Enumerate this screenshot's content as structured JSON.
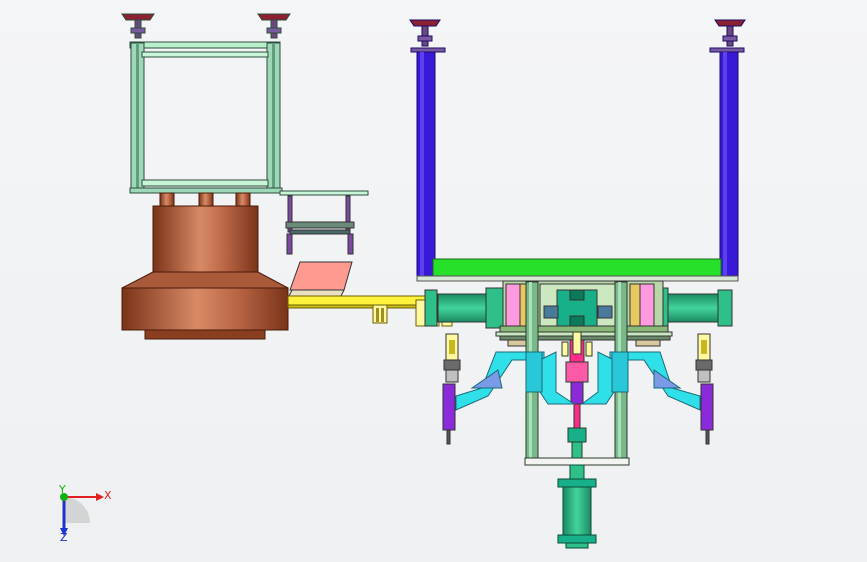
{
  "viewport": {
    "background": "#f3f4f6"
  },
  "triad": {
    "x_label": "X",
    "y_label": "Y",
    "z_label": "Z",
    "colors": {
      "x": "#e02020",
      "y": "#10b010",
      "z": "#2030d0"
    }
  },
  "palette": {
    "outline": "#333333",
    "frame_green": "#9fd8b8",
    "frame_dark_green": "#5f9f7f",
    "frame_blue": "#3a18d8",
    "base_bright_green": "#27e02a",
    "copper": "#9b4a2a",
    "copper_light": "#d08060",
    "yellow_arm": "#fff23a",
    "cyan_bracket": "#30e0e8",
    "magenta_part": "#ff2a8a",
    "purple_part": "#8a2ad8",
    "teal_block": "#18b088",
    "cylinder_green": "#2fbf88",
    "pink_plate": "#ff9a90",
    "leveling_foot": "#8a2030"
  },
  "icons": [
    "leveling-foot-icon",
    "copper-bell-icon",
    "pneumatic-cylinder-icon",
    "coordinate-triad-icon"
  ]
}
